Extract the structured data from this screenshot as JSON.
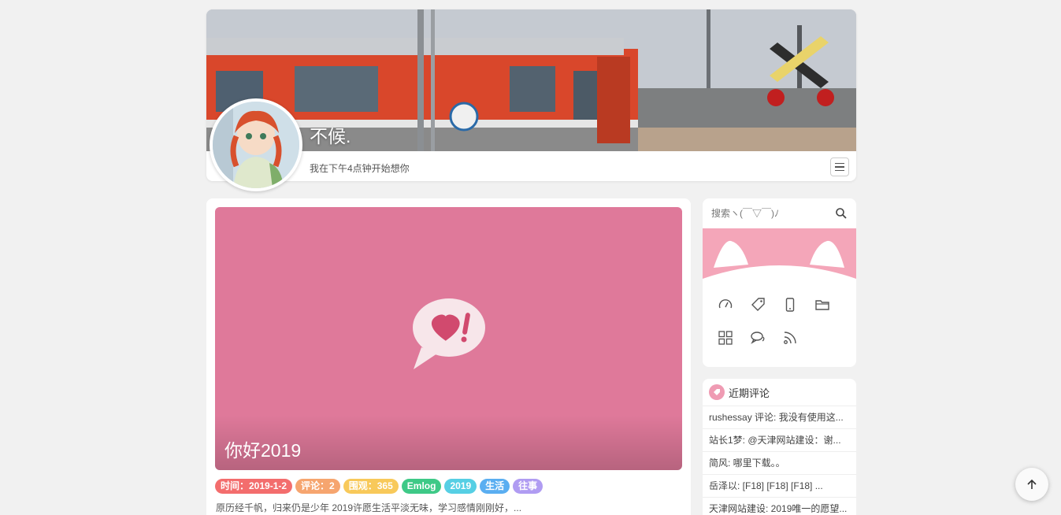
{
  "header": {
    "site_name": "不候.",
    "description": "我在下午4点钟开始想你"
  },
  "post": {
    "title": "你好2019",
    "tags": [
      {
        "label": "时间：2019-1-2",
        "color": "#f36d6d"
      },
      {
        "label": "评论：2",
        "color": "#f6a56f"
      },
      {
        "label": "围观：365",
        "color": "#f8c95a"
      },
      {
        "label": "Emlog",
        "color": "#3ec987"
      },
      {
        "label": "2019",
        "color": "#56cfe4"
      },
      {
        "label": "生活",
        "color": "#5aaef1"
      },
      {
        "label": "往事",
        "color": "#b09cf2"
      }
    ],
    "excerpt": "原历经千帆，归来仍是少年 2019许愿生活平淡无味，学习感情刚刚好，..."
  },
  "sidebar": {
    "search_placeholder": "搜索ヽ(￣▽￣)ﾉ",
    "nav_icons": [
      "dashboard-icon",
      "tag-icon",
      "mobile-icon",
      "folder-icon",
      "grid-icon",
      "chat-icon",
      "rss-icon"
    ],
    "comments_title": "近期评论",
    "comments": [
      "rushessay 评论: 我没有使用这...",
      "站长1梦: @天津网站建设：谢...",
      "简风: 哪里下载。。",
      "岳泽以: [F18]  [F18]  [F18] ...",
      "天津网站建设: 2019唯一的愿望..."
    ]
  },
  "colors": {
    "accent_pink": "#df799a",
    "background": "#f1f1f1"
  }
}
